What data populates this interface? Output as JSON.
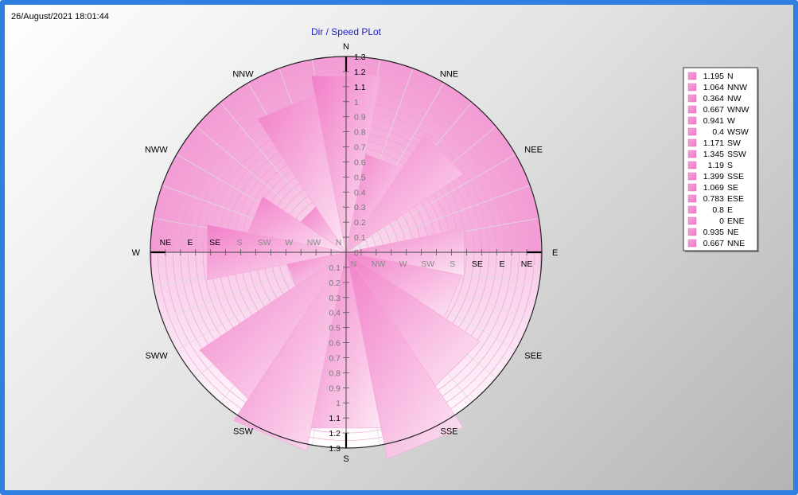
{
  "timestamp": "26/August/2021 18:01:44",
  "chart_data": {
    "type": "polar-area",
    "title": "Dir / Speed PLot",
    "radial_range": [
      0,
      1.3
    ],
    "radial_ticks": [
      0,
      0.1,
      0.2,
      0.3,
      0.4,
      0.5,
      0.6,
      0.7,
      0.8,
      0.9,
      1,
      1.1,
      1.2,
      1.3
    ],
    "compass_labels": [
      "N",
      "NNE",
      "NEE",
      "E",
      "SEE",
      "SSE",
      "S",
      "SSW",
      "SWW",
      "W",
      "NWW",
      "NNW"
    ],
    "axis_tick_labels_left": [
      "NE",
      "E",
      "SE",
      "S",
      "SW",
      "W",
      "NW",
      "N"
    ],
    "axis_tick_labels_right": [
      "N",
      "NW",
      "W",
      "SW",
      "S",
      "SE",
      "E",
      "NE"
    ],
    "directions": [
      "N",
      "NNE",
      "NE",
      "ENE",
      "E",
      "ESE",
      "SE",
      "SSE",
      "S",
      "SSW",
      "SW",
      "WSW",
      "W",
      "WNW",
      "NW",
      "NNW"
    ],
    "values": [
      1.195,
      0.667,
      0.935,
      0,
      0.8,
      0.783,
      1.069,
      1.399,
      1.19,
      1.345,
      1.171,
      0.4,
      0.941,
      0.667,
      0.364,
      1.064
    ],
    "legend": [
      {
        "value": "1.195",
        "label": "N"
      },
      {
        "value": "1.064",
        "label": "NNW"
      },
      {
        "value": "0.364",
        "label": "NW"
      },
      {
        "value": "0.667",
        "label": "WNW"
      },
      {
        "value": "0.941",
        "label": "W"
      },
      {
        "value": "0.4",
        "label": "WSW"
      },
      {
        "value": "1.171",
        "label": "SW"
      },
      {
        "value": "1.345",
        "label": "SSW"
      },
      {
        "value": "1.19",
        "label": "S"
      },
      {
        "value": "1.399",
        "label": "SSE"
      },
      {
        "value": "1.069",
        "label": "SE"
      },
      {
        "value": "0.783",
        "label": "ESE"
      },
      {
        "value": "0.8",
        "label": "E"
      },
      {
        "value": "0",
        "label": "ENE"
      },
      {
        "value": "0.935",
        "label": "NE"
      },
      {
        "value": "0.667",
        "label": "NNE"
      }
    ],
    "legend_position": "right",
    "colors": {
      "fill": "#f08ccc",
      "fill_light": "#fde8f5",
      "title": "#1f1fcc"
    }
  }
}
